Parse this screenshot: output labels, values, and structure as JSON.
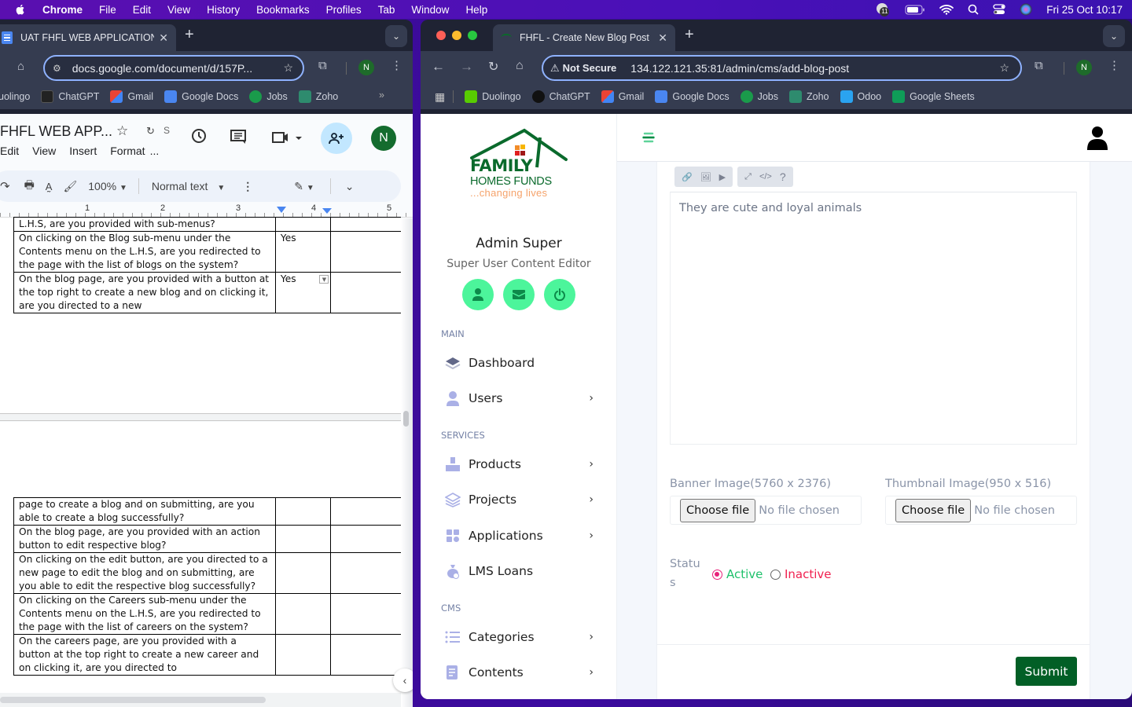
{
  "menubar": {
    "app": "Chrome",
    "items": [
      "File",
      "Edit",
      "View",
      "History",
      "Bookmarks",
      "Profiles",
      "Tab",
      "Window",
      "Help"
    ],
    "notification_count": "11",
    "datetime": "Fri 25 Oct  10:17"
  },
  "left_window": {
    "tab_title": "UAT FHFL WEB APPLICATION",
    "url": "docs.google.com/document/d/157P...",
    "profile_initial": "N",
    "bookmarks": [
      "uolingo",
      "ChatGPT",
      "Gmail",
      "Google Docs",
      "Jobs",
      "Zoho"
    ],
    "docs": {
      "title": "FHFL WEB APP...",
      "sync_label": "S",
      "menu": [
        "Edit",
        "View",
        "Insert",
        "Format",
        "..."
      ],
      "zoom": "100%",
      "style": "Normal text",
      "ruler_marks": [
        "1",
        "2",
        "3",
        "4",
        "5"
      ],
      "user_initial": "N",
      "table_rows_top": [
        {
          "q": "L.H.S, are you provided with sub-menus?",
          "a": ""
        },
        {
          "q": "On clicking on the Blog sub-menu under the Contents menu on the L.H.S, are you redirected to the page with the list of blogs on the system?",
          "a": "Yes"
        },
        {
          "q": "On the blog page, are you provided with a button at the top right to create a new blog and on clicking it, are you directed to a new",
          "a": "Yes"
        }
      ],
      "table_rows_bottom": [
        {
          "q": "page to create a blog and on submitting, are you able to create a blog successfully?",
          "a": ""
        },
        {
          "q": "On the blog page, are you provided with an action button to edit respective blog?",
          "a": ""
        },
        {
          "q": "On clicking on the edit button, are you directed to a new page to edit the blog and on submitting, are you able to edit the respective blog successfully?",
          "a": ""
        },
        {
          "q": "On clicking on the Careers sub-menu under the Contents menu on the L.H.S, are you redirected to the page with the list of careers on the system?",
          "a": ""
        },
        {
          "q": "On the careers page, are you provided with a button at the top right to create a new career and on clicking it, are you directed to",
          "a": ""
        }
      ]
    }
  },
  "right_window": {
    "tab_title": "FHFL - Create New Blog Post",
    "security_label": "Not Secure",
    "url": "134.122.121.35:81/admin/cms/add-blog-post",
    "profile_initial": "N",
    "bookmarks": [
      "Duolingo",
      "ChatGPT",
      "Gmail",
      "Google Docs",
      "Jobs",
      "Zoho",
      "Odoo",
      "Google Sheets"
    ]
  },
  "app": {
    "logo": {
      "line1": "FAMILY",
      "line2": "HOMES FUNDS",
      "line3": "...changing lives"
    },
    "user": {
      "name": "Admin Super",
      "role": "Super User Content Editor"
    },
    "sections": {
      "main": "MAIN",
      "services": "SERVICES",
      "cms": "CMS"
    },
    "nav": {
      "dashboard": "Dashboard",
      "users": "Users",
      "products": "Products",
      "projects": "Projects",
      "applications": "Applications",
      "lms_loans": "LMS Loans",
      "categories": "Categories",
      "contents": "Contents"
    },
    "form": {
      "body_text": "They are cute and loyal animals",
      "banner_label": "Banner Image(5760 x 2376)",
      "thumbnail_label": "Thumbnail Image(950 x 516)",
      "choose_file": "Choose file",
      "no_file": "No file chosen",
      "status_label_1": "Statu",
      "status_label_2": "s",
      "status_active": "Active",
      "status_inactive": "Inactive",
      "status_selected": "Active",
      "submit": "Submit"
    },
    "colors": {
      "brand_green": "#025f26",
      "accent_mint": "#4cf59b",
      "active": "#1fc16b",
      "inactive": "#f0204f"
    }
  }
}
